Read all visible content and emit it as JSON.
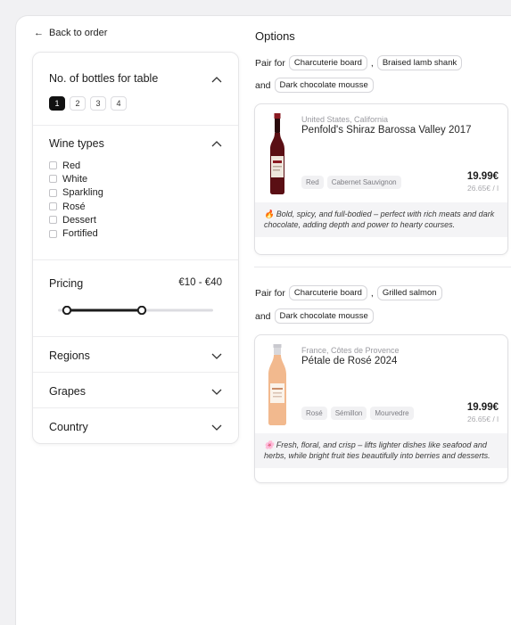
{
  "back_label": "Back to order",
  "filters": {
    "bottles": {
      "title": "No. of bottles for table",
      "options": [
        "1",
        "2",
        "3",
        "4"
      ],
      "selected": "1"
    },
    "wine_types": {
      "title": "Wine types",
      "items": [
        "Red",
        "White",
        "Sparkling",
        "Rosé",
        "Dessert",
        "Fortified"
      ]
    },
    "pricing": {
      "title": "Pricing",
      "range_label": "€10 - €40"
    },
    "regions": {
      "title": "Regions"
    },
    "grapes": {
      "title": "Grapes"
    },
    "country": {
      "title": "Country"
    }
  },
  "options": {
    "title": "Options",
    "pairings": [
      {
        "pair_for": "Pair for",
        "comma": ",",
        "and": "and",
        "dishes": [
          "Charcuterie board",
          "Braised lamb shank",
          "Dark chocolate mousse"
        ],
        "wine": {
          "region": "United States, California",
          "name": "Penfold's Shiraz Barossa Valley 2017",
          "tags": [
            "Red",
            "Cabernet Sauvignon"
          ],
          "price": "19.99€",
          "unit_price": "26.65€ / l",
          "note": "Bold, spicy, and full-bodied – perfect with rich meats and dark chocolate, adding depth and power to hearty courses.",
          "note_icon": "🔥",
          "bottle_color": "#5a0f14"
        }
      },
      {
        "pair_for": "Pair for",
        "comma": ",",
        "and": "and",
        "dishes": [
          "Charcuterie board",
          "Grilled salmon",
          "Dark chocolate mousse"
        ],
        "wine": {
          "region": "France, Côtes de Provence",
          "name": "Pétale de Rosé 2024",
          "tags": [
            "Rosé",
            "Sémillon",
            "Mourvedre"
          ],
          "price": "19.99€",
          "unit_price": "26.65€ / l",
          "note": "Fresh, floral, and crisp – lifts lighter dishes like seafood and herbs, while bright fruit ties beautifully into berries and desserts.",
          "note_icon": "🌸",
          "bottle_color": "#f2b98e"
        }
      }
    ]
  }
}
